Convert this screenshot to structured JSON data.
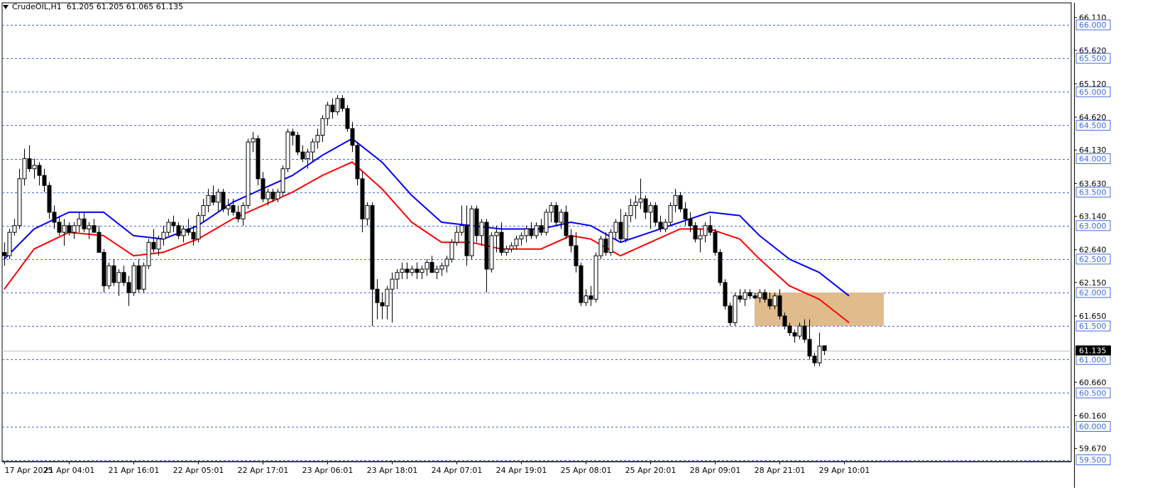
{
  "header": {
    "symbol": "CrudeOIL,H1",
    "ohlc": "61.205 61.205 61.065 61.135"
  },
  "chart_data": {
    "type": "candlestick",
    "title": "CrudeOIL,H1",
    "ylim": [
      59.45,
      66.35
    ],
    "y_ticks": [
      "66.110",
      "65.620",
      "65.120",
      "64.620",
      "64.130",
      "63.630",
      "63.140",
      "62.640",
      "62.150",
      "61.650",
      "61.150",
      "60.660",
      "60.160",
      "59.670"
    ],
    "levels": [
      {
        "value": 66.0,
        "label": "66.000"
      },
      {
        "value": 65.5,
        "label": "65.500"
      },
      {
        "value": 65.0,
        "label": "65.000"
      },
      {
        "value": 64.5,
        "label": "64.500"
      },
      {
        "value": 64.0,
        "label": "64.000"
      },
      {
        "value": 63.5,
        "label": "63.500"
      },
      {
        "value": 63.0,
        "label": "63.000"
      },
      {
        "value": 62.5,
        "label": "62.500"
      },
      {
        "value": 62.0,
        "label": "62.000"
      },
      {
        "value": 61.5,
        "label": "61.500"
      },
      {
        "value": 61.0,
        "label": "61.000"
      },
      {
        "value": 60.5,
        "label": "60.500"
      },
      {
        "value": 60.0,
        "label": "60.000"
      },
      {
        "value": 59.5,
        "label": "59.500"
      }
    ],
    "current_price": {
      "value": 61.135,
      "label": "61.135"
    },
    "x_ticks": [
      "17 Apr 2025",
      "21 Apr 04:01",
      "21 Apr 16:01",
      "22 Apr 05:01",
      "22 Apr 17:01",
      "23 Apr 06:01",
      "23 Apr 18:01",
      "24 Apr 07:01",
      "24 Apr 19:01",
      "25 Apr 08:01",
      "25 Apr 20:01",
      "28 Apr 09:01",
      "28 Apr 21:01",
      "29 Apr 10:01"
    ],
    "x_tick_bar_index": [
      0,
      13,
      26,
      39,
      52,
      65,
      78,
      91,
      104,
      117,
      130,
      143,
      156,
      169
    ],
    "candles": [
      [
        62.6,
        62.75,
        62.4,
        62.55
      ],
      [
        62.55,
        62.95,
        62.5,
        62.9
      ],
      [
        62.9,
        63.1,
        62.85,
        63.0
      ],
      [
        63.0,
        63.85,
        62.95,
        63.7
      ],
      [
        63.7,
        64.15,
        63.6,
        64.0
      ],
      [
        64.0,
        64.2,
        63.8,
        63.85
      ],
      [
        63.85,
        64.0,
        63.7,
        63.9
      ],
      [
        63.9,
        63.95,
        63.6,
        63.75
      ],
      [
        63.75,
        63.85,
        63.5,
        63.6
      ],
      [
        63.6,
        63.65,
        63.1,
        63.2
      ],
      [
        63.2,
        63.3,
        62.95,
        63.05
      ],
      [
        63.05,
        63.15,
        62.85,
        62.9
      ],
      [
        62.9,
        63.1,
        62.7,
        63.0
      ],
      [
        63.0,
        63.05,
        62.85,
        62.9
      ],
      [
        62.9,
        63.05,
        62.8,
        63.0
      ],
      [
        63.0,
        63.2,
        62.9,
        63.1
      ],
      [
        63.1,
        63.2,
        62.9,
        62.95
      ],
      [
        62.95,
        63.05,
        62.8,
        63.0
      ],
      [
        63.0,
        63.1,
        62.95,
        62.9
      ],
      [
        62.9,
        63.0,
        62.6,
        62.6
      ],
      [
        62.6,
        62.65,
        62.0,
        62.1
      ],
      [
        62.1,
        62.45,
        62.05,
        62.4
      ],
      [
        62.4,
        62.5,
        62.1,
        62.15
      ],
      [
        62.15,
        62.35,
        61.95,
        62.3
      ],
      [
        62.3,
        62.4,
        62.1,
        62.15
      ],
      [
        62.15,
        62.25,
        61.8,
        62.0
      ],
      [
        62.0,
        62.45,
        61.95,
        62.4
      ],
      [
        62.4,
        62.5,
        62.0,
        62.05
      ],
      [
        62.05,
        62.45,
        62.0,
        62.4
      ],
      [
        62.4,
        62.8,
        62.35,
        62.75
      ],
      [
        62.75,
        62.95,
        62.6,
        62.65
      ],
      [
        62.65,
        62.85,
        62.55,
        62.8
      ],
      [
        62.8,
        63.0,
        62.7,
        62.9
      ],
      [
        62.9,
        63.1,
        62.85,
        63.05
      ],
      [
        63.05,
        63.15,
        62.9,
        63.0
      ],
      [
        63.0,
        63.05,
        62.8,
        62.85
      ],
      [
        62.85,
        63.0,
        62.75,
        62.95
      ],
      [
        62.95,
        63.1,
        62.85,
        62.9
      ],
      [
        62.9,
        63.0,
        62.7,
        62.8
      ],
      [
        62.8,
        63.2,
        62.75,
        63.15
      ],
      [
        63.15,
        63.4,
        63.05,
        63.3
      ],
      [
        63.3,
        63.55,
        63.2,
        63.45
      ],
      [
        63.45,
        63.6,
        63.3,
        63.35
      ],
      [
        63.35,
        63.55,
        63.2,
        63.5
      ],
      [
        63.5,
        63.55,
        63.2,
        63.25
      ],
      [
        63.25,
        63.4,
        63.15,
        63.3
      ],
      [
        63.3,
        63.4,
        63.15,
        63.2
      ],
      [
        63.2,
        63.3,
        63.05,
        63.1
      ],
      [
        63.1,
        63.35,
        63.0,
        63.3
      ],
      [
        63.3,
        64.3,
        63.25,
        64.25
      ],
      [
        64.25,
        64.4,
        64.1,
        64.3
      ],
      [
        64.3,
        64.35,
        63.6,
        63.7
      ],
      [
        63.7,
        63.8,
        63.35,
        63.4
      ],
      [
        63.4,
        63.55,
        63.3,
        63.5
      ],
      [
        63.5,
        63.55,
        63.35,
        63.4
      ],
      [
        63.4,
        63.55,
        63.35,
        63.5
      ],
      [
        63.5,
        63.9,
        63.45,
        63.85
      ],
      [
        63.85,
        64.45,
        63.8,
        64.4
      ],
      [
        64.4,
        64.45,
        64.2,
        64.35
      ],
      [
        64.35,
        64.4,
        64.05,
        64.1
      ],
      [
        64.1,
        64.2,
        63.95,
        64.0
      ],
      [
        64.0,
        64.15,
        63.85,
        64.1
      ],
      [
        64.1,
        64.3,
        63.95,
        64.25
      ],
      [
        64.25,
        64.45,
        64.15,
        64.35
      ],
      [
        64.35,
        64.65,
        64.25,
        64.6
      ],
      [
        64.6,
        64.85,
        64.5,
        64.8
      ],
      [
        64.8,
        64.9,
        64.6,
        64.7
      ],
      [
        64.7,
        64.95,
        64.65,
        64.9
      ],
      [
        64.9,
        64.95,
        64.7,
        64.75
      ],
      [
        64.75,
        64.8,
        64.4,
        64.45
      ],
      [
        64.45,
        64.55,
        64.1,
        64.2
      ],
      [
        64.2,
        64.25,
        63.6,
        63.7
      ],
      [
        63.7,
        63.8,
        62.9,
        63.1
      ],
      [
        63.1,
        63.35,
        63.0,
        63.3
      ],
      [
        63.3,
        63.35,
        61.5,
        62.05
      ],
      [
        62.05,
        62.2,
        61.6,
        61.85
      ],
      [
        61.85,
        62.0,
        61.6,
        61.8
      ],
      [
        61.8,
        62.1,
        61.6,
        62.05
      ],
      [
        62.05,
        62.3,
        61.55,
        62.2
      ],
      [
        62.2,
        62.35,
        62.05,
        62.3
      ],
      [
        62.3,
        62.45,
        62.2,
        62.35
      ],
      [
        62.35,
        62.45,
        62.2,
        62.3
      ],
      [
        62.3,
        62.4,
        62.25,
        62.35
      ],
      [
        62.35,
        62.45,
        62.2,
        62.3
      ],
      [
        62.3,
        62.4,
        62.2,
        62.35
      ],
      [
        62.35,
        62.5,
        62.25,
        62.45
      ],
      [
        62.45,
        62.55,
        62.3,
        62.3
      ],
      [
        62.3,
        62.4,
        62.2,
        62.35
      ],
      [
        62.35,
        62.45,
        62.25,
        62.4
      ],
      [
        62.4,
        62.55,
        62.3,
        62.5
      ],
      [
        62.5,
        62.8,
        62.45,
        62.75
      ],
      [
        62.75,
        63.0,
        62.7,
        62.9
      ],
      [
        62.9,
        63.3,
        62.85,
        63.0
      ],
      [
        63.0,
        63.3,
        62.4,
        62.55
      ],
      [
        62.55,
        63.3,
        62.5,
        63.25
      ],
      [
        63.25,
        63.3,
        62.75,
        62.85
      ],
      [
        62.85,
        63.1,
        62.7,
        63.05
      ],
      [
        63.05,
        63.1,
        62.0,
        62.35
      ],
      [
        62.35,
        62.9,
        62.3,
        62.85
      ],
      [
        62.85,
        63.0,
        62.6,
        62.9
      ],
      [
        62.9,
        63.05,
        62.55,
        62.6
      ],
      [
        62.6,
        62.7,
        62.55,
        62.65
      ],
      [
        62.65,
        62.75,
        62.6,
        62.7
      ],
      [
        62.7,
        62.85,
        62.65,
        62.8
      ],
      [
        62.8,
        62.9,
        62.7,
        62.85
      ],
      [
        62.85,
        63.0,
        62.75,
        62.95
      ],
      [
        62.95,
        63.05,
        62.8,
        62.85
      ],
      [
        62.85,
        63.05,
        62.8,
        63.0
      ],
      [
        63.0,
        63.1,
        62.85,
        62.9
      ],
      [
        62.9,
        63.25,
        62.85,
        63.2
      ],
      [
        63.2,
        63.35,
        63.05,
        63.3
      ],
      [
        63.3,
        63.35,
        63.0,
        63.05
      ],
      [
        63.05,
        63.25,
        62.95,
        63.2
      ],
      [
        63.2,
        63.3,
        62.8,
        62.85
      ],
      [
        62.85,
        62.95,
        62.6,
        62.7
      ],
      [
        62.7,
        62.9,
        62.3,
        62.4
      ],
      [
        62.4,
        62.45,
        61.8,
        61.85
      ],
      [
        61.85,
        62.05,
        61.8,
        61.95
      ],
      [
        61.95,
        62.1,
        61.8,
        61.9
      ],
      [
        61.9,
        62.6,
        61.85,
        62.55
      ],
      [
        62.55,
        62.85,
        62.5,
        62.8
      ],
      [
        62.8,
        62.9,
        62.55,
        62.6
      ],
      [
        62.6,
        62.95,
        62.55,
        62.9
      ],
      [
        62.9,
        63.1,
        62.8,
        63.05
      ],
      [
        63.05,
        63.25,
        62.75,
        62.8
      ],
      [
        62.8,
        63.2,
        62.75,
        63.15
      ],
      [
        63.15,
        63.4,
        63.05,
        63.3
      ],
      [
        63.3,
        63.45,
        63.1,
        63.35
      ],
      [
        63.35,
        63.7,
        63.25,
        63.4
      ],
      [
        63.4,
        63.45,
        63.1,
        63.2
      ],
      [
        63.2,
        63.35,
        62.95,
        63.3
      ],
      [
        63.3,
        63.35,
        63.0,
        63.05
      ],
      [
        63.05,
        63.15,
        62.9,
        62.95
      ],
      [
        62.95,
        63.1,
        62.9,
        63.05
      ],
      [
        63.05,
        63.35,
        63.0,
        63.3
      ],
      [
        63.3,
        63.55,
        63.2,
        63.45
      ],
      [
        63.45,
        63.5,
        63.2,
        63.25
      ],
      [
        63.25,
        63.35,
        63.0,
        63.1
      ],
      [
        63.1,
        63.2,
        62.9,
        63.0
      ],
      [
        63.0,
        63.05,
        62.75,
        62.8
      ],
      [
        62.8,
        62.95,
        62.6,
        62.85
      ],
      [
        62.85,
        63.05,
        62.75,
        63.0
      ],
      [
        63.0,
        63.15,
        62.85,
        62.9
      ],
      [
        62.9,
        62.95,
        62.55,
        62.6
      ],
      [
        62.6,
        62.65,
        62.1,
        62.15
      ],
      [
        62.15,
        62.2,
        61.75,
        61.8
      ],
      [
        61.8,
        61.85,
        61.5,
        61.55
      ],
      [
        61.55,
        62.0,
        61.5,
        61.95
      ],
      [
        61.95,
        62.05,
        61.85,
        61.9
      ],
      [
        61.9,
        62.05,
        61.8,
        62.0
      ],
      [
        62.0,
        62.05,
        61.9,
        61.95
      ],
      [
        61.95,
        62.0,
        61.9,
        61.92
      ],
      [
        61.92,
        62.05,
        61.85,
        62.0
      ],
      [
        62.0,
        62.05,
        61.85,
        61.9
      ],
      [
        61.9,
        62.0,
        61.75,
        61.8
      ],
      [
        61.8,
        62.0,
        61.75,
        61.95
      ],
      [
        61.95,
        62.05,
        61.6,
        61.65
      ],
      [
        61.65,
        61.7,
        61.45,
        61.5
      ],
      [
        61.5,
        61.55,
        61.35,
        61.4
      ],
      [
        61.4,
        61.45,
        61.25,
        61.35
      ],
      [
        61.35,
        61.55,
        61.3,
        61.5
      ],
      [
        61.5,
        61.6,
        61.25,
        61.3
      ],
      [
        61.3,
        61.6,
        61.0,
        61.05
      ],
      [
        61.05,
        61.1,
        60.9,
        60.95
      ],
      [
        60.95,
        61.4,
        60.9,
        61.2
      ],
      [
        61.205,
        61.205,
        61.065,
        61.135
      ]
    ],
    "ma_blue": [
      [
        0,
        62.5
      ],
      [
        6,
        62.95
      ],
      [
        13,
        63.2
      ],
      [
        20,
        63.2
      ],
      [
        26,
        62.85
      ],
      [
        32,
        62.8
      ],
      [
        39,
        63.0
      ],
      [
        46,
        63.35
      ],
      [
        52,
        63.55
      ],
      [
        58,
        63.75
      ],
      [
        64,
        64.05
      ],
      [
        70,
        64.3
      ],
      [
        76,
        63.95
      ],
      [
        82,
        63.45
      ],
      [
        88,
        63.05
      ],
      [
        94,
        63.0
      ],
      [
        100,
        62.95
      ],
      [
        108,
        62.95
      ],
      [
        114,
        63.05
      ],
      [
        118,
        63.0
      ],
      [
        124,
        62.75
      ],
      [
        130,
        62.9
      ],
      [
        136,
        63.05
      ],
      [
        142,
        63.2
      ],
      [
        148,
        63.15
      ],
      [
        152,
        62.85
      ],
      [
        158,
        62.5
      ],
      [
        164,
        62.3
      ],
      [
        170,
        61.95
      ]
    ],
    "ma_red": [
      [
        0,
        62.05
      ],
      [
        6,
        62.65
      ],
      [
        13,
        62.9
      ],
      [
        20,
        62.85
      ],
      [
        26,
        62.55
      ],
      [
        32,
        62.6
      ],
      [
        39,
        62.8
      ],
      [
        46,
        63.1
      ],
      [
        52,
        63.3
      ],
      [
        58,
        63.5
      ],
      [
        64,
        63.75
      ],
      [
        70,
        63.95
      ],
      [
        76,
        63.55
      ],
      [
        82,
        63.05
      ],
      [
        88,
        62.75
      ],
      [
        94,
        62.75
      ],
      [
        100,
        62.65
      ],
      [
        108,
        62.65
      ],
      [
        114,
        62.85
      ],
      [
        118,
        62.8
      ],
      [
        124,
        62.55
      ],
      [
        130,
        62.75
      ],
      [
        136,
        62.95
      ],
      [
        142,
        62.95
      ],
      [
        148,
        62.8
      ],
      [
        152,
        62.5
      ],
      [
        158,
        62.1
      ],
      [
        164,
        61.9
      ],
      [
        170,
        61.55
      ]
    ],
    "zone": {
      "bar_from": 151,
      "bar_to": 177,
      "low": 61.5,
      "high": 62.0,
      "color": "#deb887"
    },
    "colors": {
      "grid": "#4169e1",
      "ma_blue": "#0000ff",
      "ma_red": "#ff0000",
      "candle": "#000000"
    }
  }
}
